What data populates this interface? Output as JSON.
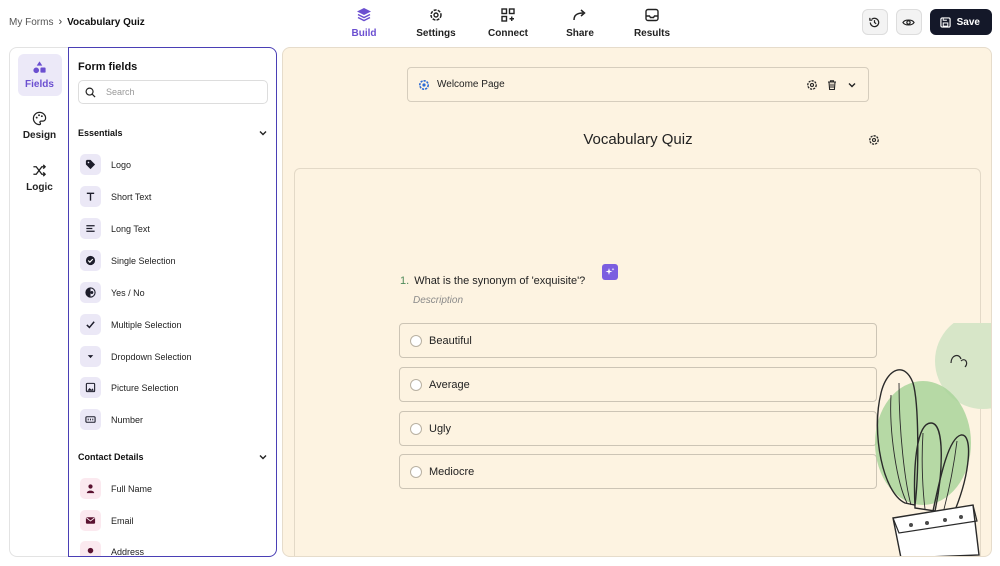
{
  "breadcrumb": {
    "root": "My Forms",
    "separator": "›",
    "current": "Vocabulary Quiz"
  },
  "nav": {
    "build": "Build",
    "settings": "Settings",
    "connect": "Connect",
    "share": "Share",
    "results": "Results"
  },
  "actions": {
    "save": "Save"
  },
  "rail": {
    "fields": "Fields",
    "design": "Design",
    "logic": "Logic"
  },
  "panel": {
    "title": "Form fields",
    "search_placeholder": "Search",
    "essentials": {
      "heading": "Essentials",
      "items": [
        "Logo",
        "Short Text",
        "Long Text",
        "Single Selection",
        "Yes / No",
        "Multiple Selection",
        "Dropdown Selection",
        "Picture Selection",
        "Number"
      ]
    },
    "contact": {
      "heading": "Contact Details",
      "items": [
        "Full Name",
        "Email",
        "Address"
      ]
    }
  },
  "canvas": {
    "welcome_label": "Welcome Page",
    "quiz_title": "Vocabulary Quiz",
    "question_number": "1.",
    "question_text": "What is the synonym of 'exquisite'?",
    "description_placeholder": "Description",
    "options": [
      "Beautiful",
      "Average",
      "Ugly",
      "Mediocre"
    ]
  },
  "colors": {
    "accent": "#6b4fd0",
    "canvas_bg": "#fdf3e1",
    "save_bg": "#141829",
    "panel_border": "#4a3fb5"
  }
}
